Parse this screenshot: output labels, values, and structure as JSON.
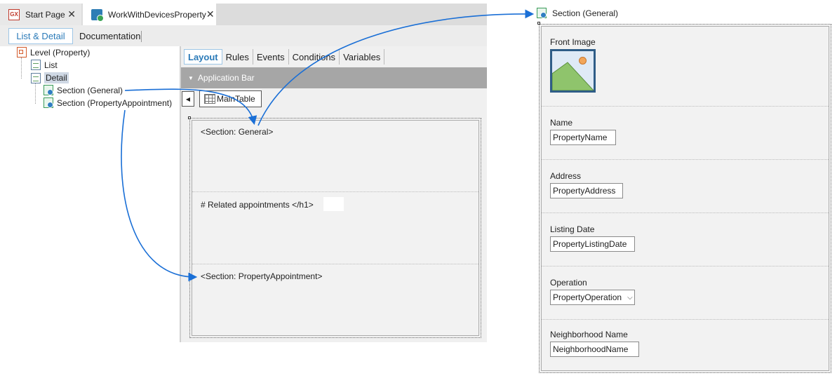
{
  "doc_tabs": [
    {
      "label": "Start Page",
      "icon": "gx-icon",
      "icon_text": "GX",
      "close": "✕"
    },
    {
      "label": "WorkWithDevicesProperty",
      "icon": "work-with-devices-icon",
      "close": "✕"
    }
  ],
  "sub_tabs": {
    "active": "List & Detail",
    "other": "Documentation"
  },
  "tree": {
    "level": "Level (Property)",
    "list": "List",
    "detail": "Detail",
    "section_general": "Section (General)",
    "section_appointment": "Section (PropertyAppointment)"
  },
  "editor_tabs": [
    "Layout",
    "Rules",
    "Events",
    "Conditions",
    "Variables"
  ],
  "app_bar": "Application Bar",
  "back_glyph": "◀",
  "main_table": "MainTable",
  "cells": {
    "general": "<Section: General>",
    "related": "# Related appointments </h1>",
    "appointment": "<Section: PropertyAppointment>"
  },
  "right_panel": {
    "title": "Section (General)",
    "front_image_label": "Front Image",
    "fields": [
      {
        "label": "Name",
        "value": "PropertyName"
      },
      {
        "label": "Address",
        "value": "PropertyAddress"
      },
      {
        "label": "Listing Date",
        "value": "PropertyListingDate"
      },
      {
        "label": "Operation",
        "value": "PropertyOperation",
        "dropdown": "⌵"
      },
      {
        "label": "Neighborhood Name",
        "value": "NeighborhoodName"
      }
    ]
  },
  "colors": {
    "accent": "#2a7ab8",
    "arrow": "#1a6fd6",
    "app_bar": "#a6a6a6"
  }
}
